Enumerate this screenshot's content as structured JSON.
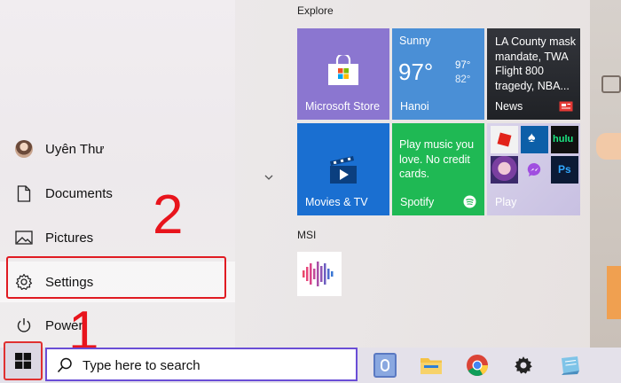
{
  "left_rail": {
    "user_name": "Uyên Thư",
    "documents_label": "Documents",
    "pictures_label": "Pictures",
    "settings_label": "Settings",
    "power_label": "Power"
  },
  "groups": {
    "explore_title": "Explore",
    "msi_title": "MSI"
  },
  "tiles": {
    "store_label": "Microsoft Store",
    "weather_condition": "Sunny",
    "weather_temp": "97°",
    "weather_high": "97°",
    "weather_low": "82°",
    "weather_city": "Hanoi",
    "news_headline": "LA County mask mandate, TWA Flight 800 tragedy, NBA...",
    "news_label": "News",
    "movies_label": "Movies & TV",
    "spotify_text": "Play music you love. No credit cards.",
    "spotify_label": "Spotify",
    "play_label": "Play",
    "hulu_text": "hulu",
    "ps_text": "Ps"
  },
  "annotations": {
    "step1": "1",
    "step2": "2"
  },
  "taskbar": {
    "search_placeholder": "Type here to search"
  },
  "colors": {
    "store_tile": "#8b76d0",
    "weather_tile": "#4a8fd6",
    "news_tile": "#3c3f46",
    "movies_tile": "#1a6fd1",
    "spotify_tile": "#1fb954",
    "annotation": "#e8141c",
    "search_border": "#6a4ed6"
  }
}
